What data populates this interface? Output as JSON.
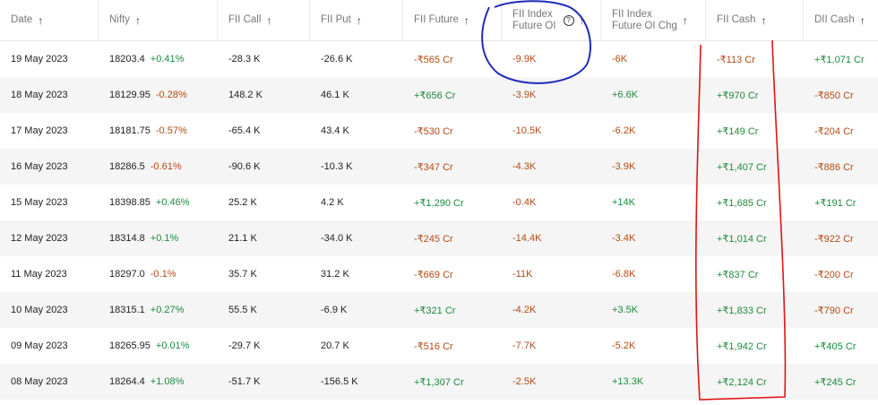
{
  "headers": [
    {
      "l1": "Date",
      "l2": ""
    },
    {
      "l1": "Nifty",
      "l2": ""
    },
    {
      "l1": "FII Call",
      "l2": ""
    },
    {
      "l1": "FII Put",
      "l2": ""
    },
    {
      "l1": "FII Future",
      "l2": ""
    },
    {
      "l1": "FII Index",
      "l2": "Future OI",
      "help": "?"
    },
    {
      "l1": "FII Index",
      "l2": "Future OI Chg"
    },
    {
      "l1": "FII Cash",
      "l2": ""
    },
    {
      "l1": "DII Cash",
      "l2": ""
    }
  ],
  "sort_arrow": "↑",
  "rows": [
    {
      "date": "19 May 2023",
      "nifty": "18203.4",
      "nifty_chg": "+0.41%",
      "nifty_dir": "pos",
      "fii_call": "-28.3 K",
      "fii_put": "-26.6 K",
      "fii_future": "-₹565 Cr",
      "fii_future_dir": "neg",
      "oi": "-9.9K",
      "oi_dir": "neg",
      "oi_chg": "-6K",
      "oi_chg_dir": "neg",
      "fii_cash": "-₹113 Cr",
      "fii_cash_dir": "neg",
      "dii_cash": "+₹1,071 Cr",
      "dii_cash_dir": "pos"
    },
    {
      "date": "18 May 2023",
      "nifty": "18129.95",
      "nifty_chg": "-0.28%",
      "nifty_dir": "neg",
      "fii_call": "148.2 K",
      "fii_put": "46.1 K",
      "fii_future": "+₹656 Cr",
      "fii_future_dir": "pos",
      "oi": "-3.9K",
      "oi_dir": "neg",
      "oi_chg": "+6.6K",
      "oi_chg_dir": "pos",
      "fii_cash": "+₹970 Cr",
      "fii_cash_dir": "pos",
      "dii_cash": "-₹850 Cr",
      "dii_cash_dir": "neg"
    },
    {
      "date": "17 May 2023",
      "nifty": "18181.75",
      "nifty_chg": "-0.57%",
      "nifty_dir": "neg",
      "fii_call": "-65.4 K",
      "fii_put": "43.4 K",
      "fii_future": "-₹530 Cr",
      "fii_future_dir": "neg",
      "oi": "-10.5K",
      "oi_dir": "neg",
      "oi_chg": "-6.2K",
      "oi_chg_dir": "neg",
      "fii_cash": "+₹149 Cr",
      "fii_cash_dir": "pos",
      "dii_cash": "-₹204 Cr",
      "dii_cash_dir": "neg"
    },
    {
      "date": "16 May 2023",
      "nifty": "18286.5",
      "nifty_chg": "-0.61%",
      "nifty_dir": "neg",
      "fii_call": "-90.6 K",
      "fii_put": "-10.3 K",
      "fii_future": "-₹347 Cr",
      "fii_future_dir": "neg",
      "oi": "-4.3K",
      "oi_dir": "neg",
      "oi_chg": "-3.9K",
      "oi_chg_dir": "neg",
      "fii_cash": "+₹1,407 Cr",
      "fii_cash_dir": "pos",
      "dii_cash": "-₹886 Cr",
      "dii_cash_dir": "neg"
    },
    {
      "date": "15 May 2023",
      "nifty": "18398.85",
      "nifty_chg": "+0.46%",
      "nifty_dir": "pos",
      "fii_call": "25.2 K",
      "fii_put": "4.2 K",
      "fii_future": "+₹1,290 Cr",
      "fii_future_dir": "pos",
      "oi": "-0.4K",
      "oi_dir": "neg",
      "oi_chg": "+14K",
      "oi_chg_dir": "pos",
      "fii_cash": "+₹1,685 Cr",
      "fii_cash_dir": "pos",
      "dii_cash": "+₹191 Cr",
      "dii_cash_dir": "pos"
    },
    {
      "date": "12 May 2023",
      "nifty": "18314.8",
      "nifty_chg": "+0.1%",
      "nifty_dir": "pos",
      "fii_call": "21.1 K",
      "fii_put": "-34.0 K",
      "fii_future": "-₹245 Cr",
      "fii_future_dir": "neg",
      "oi": "-14.4K",
      "oi_dir": "neg",
      "oi_chg": "-3.4K",
      "oi_chg_dir": "neg",
      "fii_cash": "+₹1,014 Cr",
      "fii_cash_dir": "pos",
      "dii_cash": "-₹922 Cr",
      "dii_cash_dir": "neg"
    },
    {
      "date": "11 May 2023",
      "nifty": "18297.0",
      "nifty_chg": "-0.1%",
      "nifty_dir": "neg",
      "fii_call": "35.7 K",
      "fii_put": "31.2 K",
      "fii_future": "-₹669 Cr",
      "fii_future_dir": "neg",
      "oi": "-11K",
      "oi_dir": "neg",
      "oi_chg": "-6.8K",
      "oi_chg_dir": "neg",
      "fii_cash": "+₹837 Cr",
      "fii_cash_dir": "pos",
      "dii_cash": "-₹200 Cr",
      "dii_cash_dir": "neg"
    },
    {
      "date": "10 May 2023",
      "nifty": "18315.1",
      "nifty_chg": "+0.27%",
      "nifty_dir": "pos",
      "fii_call": "55.5 K",
      "fii_put": "-6.9 K",
      "fii_future": "+₹321 Cr",
      "fii_future_dir": "pos",
      "oi": "-4.2K",
      "oi_dir": "neg",
      "oi_chg": "+3.5K",
      "oi_chg_dir": "pos",
      "fii_cash": "+₹1,833 Cr",
      "fii_cash_dir": "pos",
      "dii_cash": "-₹790 Cr",
      "dii_cash_dir": "neg"
    },
    {
      "date": "09 May 2023",
      "nifty": "18265.95",
      "nifty_chg": "+0.01%",
      "nifty_dir": "pos",
      "fii_call": "-29.7 K",
      "fii_put": "20.7 K",
      "fii_future": "-₹516 Cr",
      "fii_future_dir": "neg",
      "oi": "-7.7K",
      "oi_dir": "neg",
      "oi_chg": "-5.2K",
      "oi_chg_dir": "neg",
      "fii_cash": "+₹1,942 Cr",
      "fii_cash_dir": "pos",
      "dii_cash": "+₹405 Cr",
      "dii_cash_dir": "pos"
    },
    {
      "date": "08 May 2023",
      "nifty": "18264.4",
      "nifty_chg": "+1.08%",
      "nifty_dir": "pos",
      "fii_call": "-51.7 K",
      "fii_put": "-156.5 K",
      "fii_future": "+₹1,307 Cr",
      "fii_future_dir": "pos",
      "oi": "-2.5K",
      "oi_dir": "neg",
      "oi_chg": "+13.3K",
      "oi_chg_dir": "pos",
      "fii_cash": "+₹2,124 Cr",
      "fii_cash_dir": "pos",
      "dii_cash": "+₹245 Cr",
      "dii_cash_dir": "pos"
    }
  ],
  "colors": {
    "positive": "#1e8a3c",
    "negative": "#b24a14",
    "annotation_blue": "#1f2bb8",
    "annotation_red": "#e01414"
  }
}
